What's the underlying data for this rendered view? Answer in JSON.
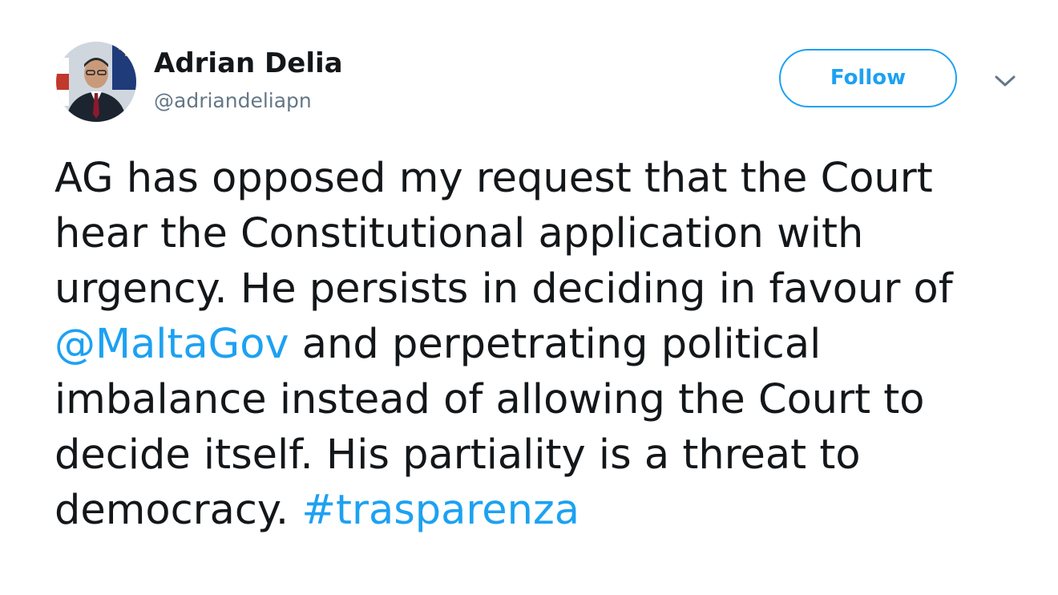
{
  "author": {
    "name": "Adrian Delia",
    "handle": "@adriandeliapn"
  },
  "actions": {
    "follow_label": "Follow"
  },
  "tweet": {
    "lines": [
      {
        "parts": [
          {
            "text": "AG has opposed my request that the Court"
          }
        ]
      },
      {
        "parts": [
          {
            "text": "hear the Constitutional application with"
          }
        ]
      },
      {
        "parts": [
          {
            "text": "urgency. He persists in deciding in favour of"
          }
        ]
      },
      {
        "parts": [
          {
            "text": "@MaltaGov",
            "link": true
          },
          {
            "text": " and perpetrating political"
          }
        ]
      },
      {
        "parts": [
          {
            "text": "imbalance instead of allowing the Court to"
          }
        ]
      },
      {
        "parts": [
          {
            "text": "decide itself. His partiality is a threat to"
          }
        ]
      },
      {
        "parts": [
          {
            "text": "democracy. "
          },
          {
            "text": "#trasparenza",
            "link": true
          }
        ]
      }
    ]
  },
  "colors": {
    "link": "#1da1f2",
    "text": "#14171a",
    "secondary_text": "#657786"
  },
  "icons": {
    "more": "chevron-down-icon"
  }
}
